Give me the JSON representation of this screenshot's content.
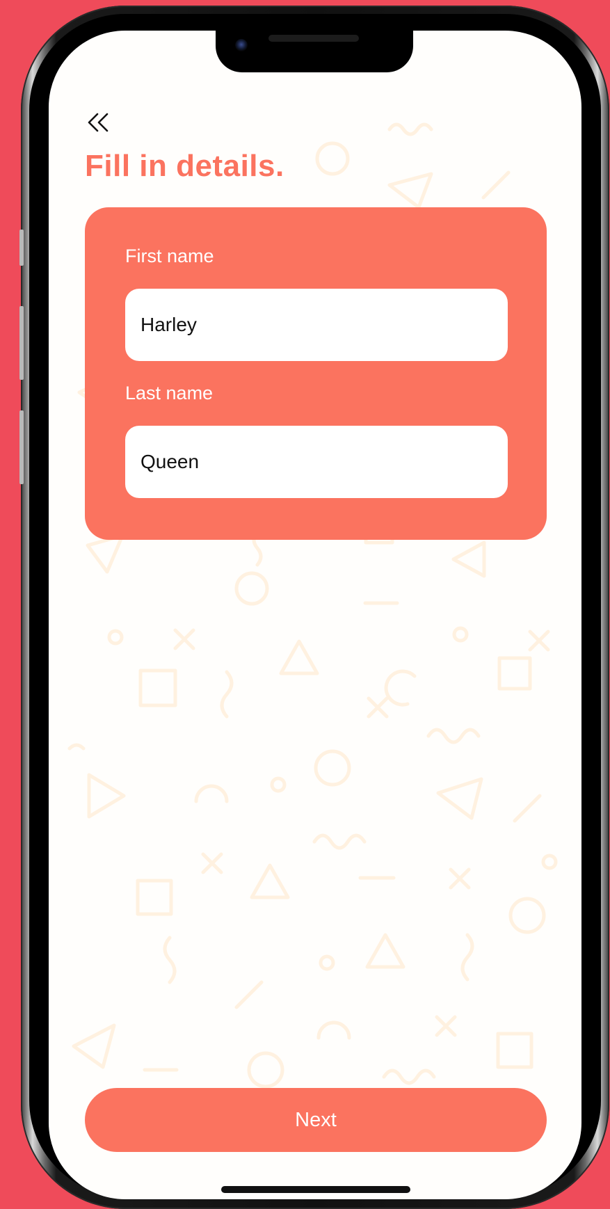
{
  "screen": {
    "title": "Fill in details.",
    "back_icon": "double-chevron-left-icon"
  },
  "form": {
    "first_name": {
      "label": "First name",
      "value": "Harley",
      "placeholder": ""
    },
    "last_name": {
      "label": "Last name",
      "value": "Queen",
      "placeholder": ""
    }
  },
  "actions": {
    "next_label": "Next"
  },
  "colors": {
    "background": "#ef4b5a",
    "accent": "#fb735f",
    "pattern": "#fff1e0"
  }
}
